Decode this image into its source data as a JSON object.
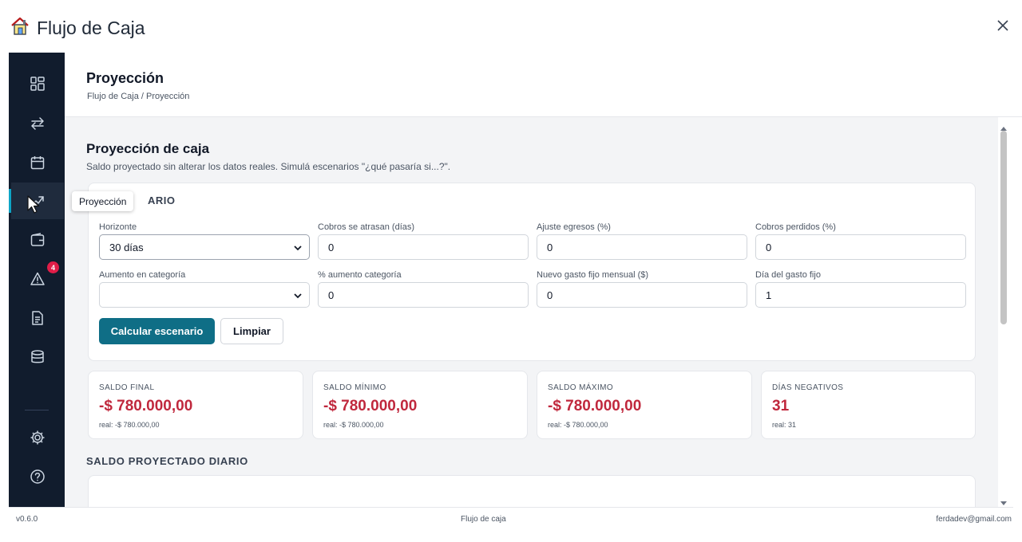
{
  "app": {
    "title": "Flujo de Caja"
  },
  "header": {
    "title": "Proyección",
    "breadcrumb": "Flujo de Caja / Proyección"
  },
  "sidebar": {
    "items": [
      {
        "icon": "dashboard-icon"
      },
      {
        "icon": "transfer-icon"
      },
      {
        "icon": "calendar-icon"
      },
      {
        "icon": "trend-icon",
        "tooltip": "Proyección",
        "active": true
      },
      {
        "icon": "wallet-icon"
      },
      {
        "icon": "alert-icon",
        "badge": "4"
      },
      {
        "icon": "document-icon"
      },
      {
        "icon": "database-icon"
      },
      {
        "icon": "gear-icon"
      },
      {
        "icon": "help-icon"
      }
    ],
    "tooltip": "Proyección",
    "alert_badge": "4"
  },
  "section": {
    "title": "Proyección de caja",
    "subtitle": "Saldo proyectado sin alterar los datos reales. Simulá escenarios \"¿qué pasaría si...?\"."
  },
  "scenario": {
    "label_visible": "ARIO",
    "fields": {
      "horizonte": {
        "label": "Horizonte",
        "value": "30 días"
      },
      "cobros_atrasan": {
        "label": "Cobros se atrasan (días)",
        "value": "0"
      },
      "ajuste_egresos": {
        "label": "Ajuste egresos (%)",
        "value": "0"
      },
      "cobros_perdidos": {
        "label": "Cobros perdidos (%)",
        "value": "0"
      },
      "aumento_categoria": {
        "label": "Aumento en categoría",
        "value": ""
      },
      "pct_aumento": {
        "label": "% aumento categoría",
        "value": "0"
      },
      "nuevo_gasto": {
        "label": "Nuevo gasto fijo mensual ($)",
        "value": "0"
      },
      "dia_gasto": {
        "label": "Día del gasto fijo",
        "value": "1"
      }
    },
    "calc_label": "Calcular escenario",
    "clear_label": "Limpiar"
  },
  "stats": [
    {
      "label": "SALDO FINAL",
      "value": "-$ 780.000,00",
      "real": "real: -$ 780.000,00"
    },
    {
      "label": "SALDO MÍNIMO",
      "value": "-$ 780.000,00",
      "real": "real: -$ 780.000,00"
    },
    {
      "label": "SALDO MÁXIMO",
      "value": "-$ 780.000,00",
      "real": "real: -$ 780.000,00"
    },
    {
      "label": "DÍAS NEGATIVOS",
      "value": "31",
      "real": "real: 31"
    }
  ],
  "chart": {
    "title": "SALDO PROYECTADO DIARIO"
  },
  "footer": {
    "version": "v0.6.0",
    "center": "Flujo de caja",
    "email": "ferdadev@gmail.com"
  },
  "colors": {
    "sidebar": "#111c2d",
    "primary": "#0f6e86",
    "negative": "#c0283d",
    "badge": "#e11d48"
  }
}
